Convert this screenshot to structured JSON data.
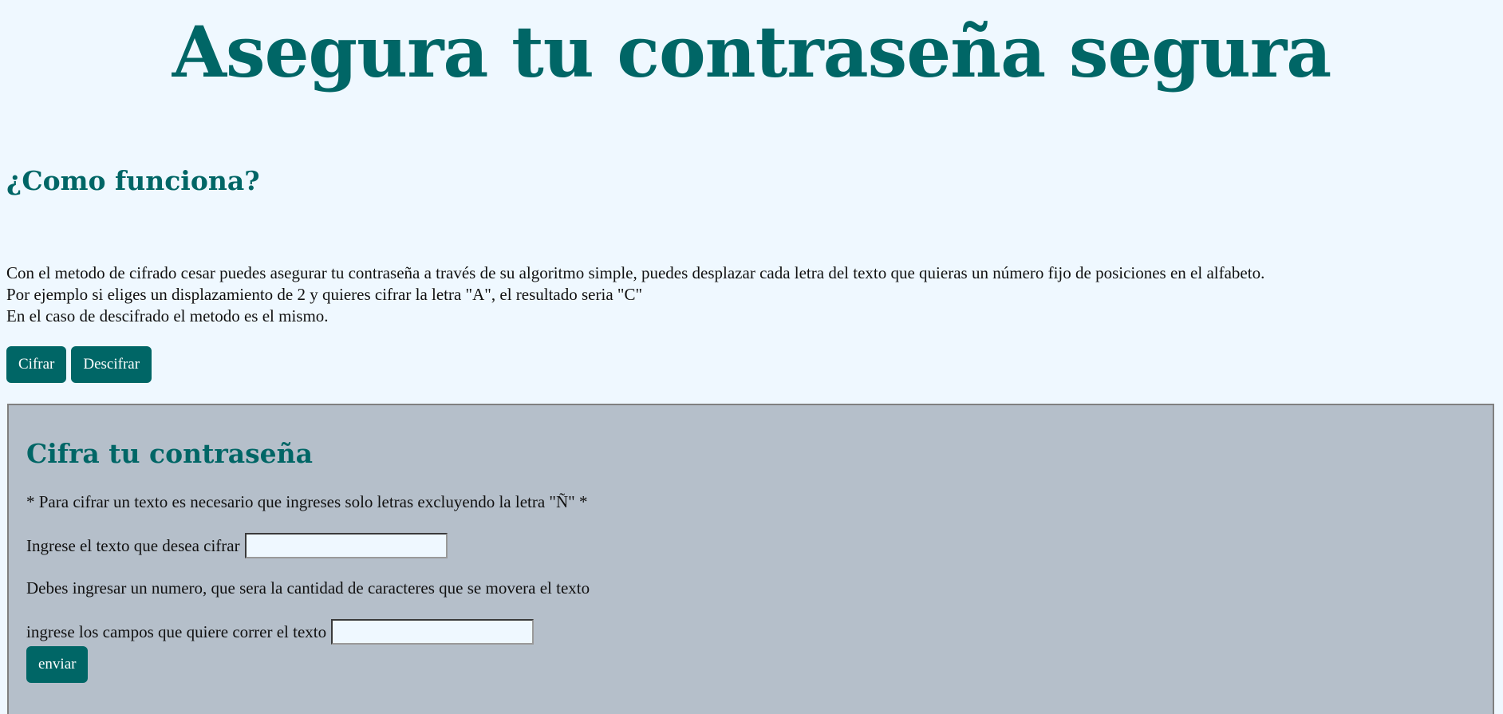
{
  "header": {
    "title": "Asegura tu contraseña segura"
  },
  "how_it_works": {
    "heading": "¿Como funciona?",
    "paragraphs": [
      "Con el metodo de cifrado cesar puedes asegurar tu contraseña a través de su algoritmo simple, puedes desplazar cada letra del texto que quieras un número fijo de posiciones en el alfabeto.",
      "Por ejemplo si eliges un displazamiento de 2 y quieres cifrar la letra \"A\", el resultado seria \"C\"",
      "En el caso de descifrado el metodo es el mismo."
    ]
  },
  "mode_buttons": {
    "encrypt_label": "Cifrar",
    "decrypt_label": "Descifrar"
  },
  "cipher_form": {
    "heading": "Cifra tu contraseña",
    "note": "* Para cifrar un texto es necesario que ingreses solo letras excluyendo la letra \"Ñ\" *",
    "text_label": "Ingrese el texto que desea cifrar",
    "text_value": "",
    "shift_note": "Debes ingresar un numero, que sera la cantidad de caracteres que se movera el texto",
    "shift_label": "ingrese los campos que quiere correr el texto",
    "shift_value": "",
    "submit_label": "enviar"
  },
  "colors": {
    "accent": "#006666",
    "page_background": "#eff8ff",
    "panel_background": "#b5bfca"
  }
}
